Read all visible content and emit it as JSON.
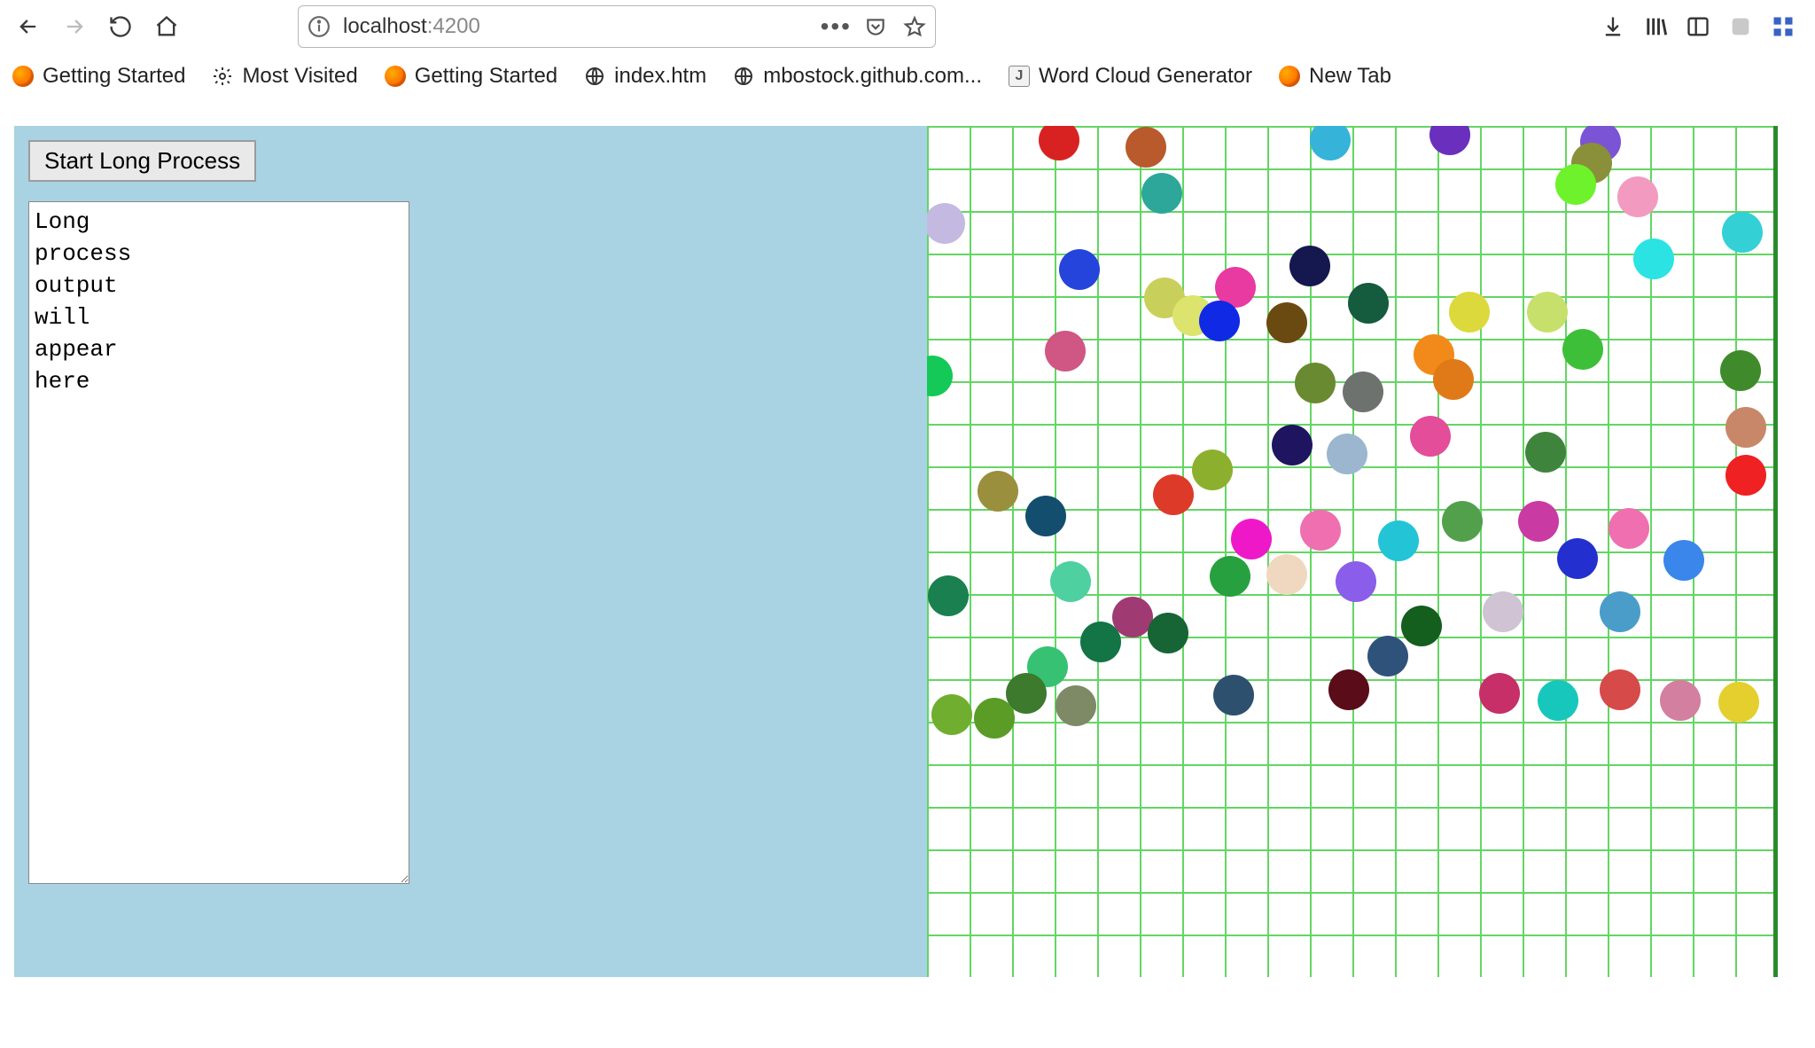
{
  "browser": {
    "url_host": "localhost",
    "url_port": ":4200"
  },
  "bookmarks": [
    {
      "label": "Getting Started",
      "icon": "fx"
    },
    {
      "label": "Most Visited",
      "icon": "gear"
    },
    {
      "label": "Getting Started",
      "icon": "fx"
    },
    {
      "label": "index.htm",
      "icon": "globe"
    },
    {
      "label": "mbostock.github.com...",
      "icon": "globe"
    },
    {
      "label": "Word Cloud Generator",
      "icon": "j"
    },
    {
      "label": "New Tab",
      "icon": "fx"
    }
  ],
  "app": {
    "start_label": "Start Long Process",
    "output_text": "Long\nprocess\noutput\nwill\nappear\nhere"
  },
  "chart_data": {
    "type": "scatter",
    "title": "",
    "xlabel": "",
    "ylabel": "",
    "xlim": [
      0,
      960
    ],
    "ylim": [
      0,
      960
    ],
    "grid": true,
    "grid_spacing": 48,
    "series": [
      {
        "name": "bubbles",
        "points": [
          {
            "x": 149,
            "y": 16,
            "color": "#d82222"
          },
          {
            "x": 247,
            "y": 24,
            "color": "#b85a2b"
          },
          {
            "x": 455,
            "y": 16,
            "color": "#36b3d8"
          },
          {
            "x": 590,
            "y": 10,
            "color": "#6a2fbc"
          },
          {
            "x": 760,
            "y": 18,
            "color": "#7a54d4"
          },
          {
            "x": 750,
            "y": 42,
            "color": "#8a8f3a"
          },
          {
            "x": 265,
            "y": 76,
            "color": "#2ca79a"
          },
          {
            "x": 732,
            "y": 66,
            "color": "#6ef22b"
          },
          {
            "x": 802,
            "y": 80,
            "color": "#f39ac1"
          },
          {
            "x": 20,
            "y": 110,
            "color": "#c4b9e0"
          },
          {
            "x": 920,
            "y": 120,
            "color": "#33d0d6"
          },
          {
            "x": 820,
            "y": 150,
            "color": "#2be3e3"
          },
          {
            "x": 172,
            "y": 162,
            "color": "#2544db"
          },
          {
            "x": 348,
            "y": 182,
            "color": "#e83aa0"
          },
          {
            "x": 432,
            "y": 158,
            "color": "#14184f"
          },
          {
            "x": 268,
            "y": 194,
            "color": "#c8d05b"
          },
          {
            "x": 300,
            "y": 214,
            "color": "#dde46e"
          },
          {
            "x": 330,
            "y": 220,
            "color": "#1029e4"
          },
          {
            "x": 406,
            "y": 222,
            "color": "#6b4a12"
          },
          {
            "x": 498,
            "y": 200,
            "color": "#155b3e"
          },
          {
            "x": 612,
            "y": 210,
            "color": "#dcd93d"
          },
          {
            "x": 700,
            "y": 210,
            "color": "#c7e06c"
          },
          {
            "x": 156,
            "y": 254,
            "color": "#d05683"
          },
          {
            "x": 572,
            "y": 258,
            "color": "#f28a1a"
          },
          {
            "x": 740,
            "y": 252,
            "color": "#3ebf39"
          },
          {
            "x": 918,
            "y": 276,
            "color": "#3f8b2b"
          },
          {
            "x": 6,
            "y": 282,
            "color": "#14c957"
          },
          {
            "x": 438,
            "y": 290,
            "color": "#698a30"
          },
          {
            "x": 492,
            "y": 300,
            "color": "#6d726f"
          },
          {
            "x": 594,
            "y": 286,
            "color": "#e07a18"
          },
          {
            "x": 924,
            "y": 340,
            "color": "#c9876a"
          },
          {
            "x": 568,
            "y": 350,
            "color": "#e34d9a"
          },
          {
            "x": 412,
            "y": 360,
            "color": "#1f1460"
          },
          {
            "x": 474,
            "y": 370,
            "color": "#9bb6ce"
          },
          {
            "x": 698,
            "y": 368,
            "color": "#3f843d"
          },
          {
            "x": 80,
            "y": 412,
            "color": "#9a8f3d"
          },
          {
            "x": 322,
            "y": 388,
            "color": "#8cb02e"
          },
          {
            "x": 278,
            "y": 416,
            "color": "#dd3a2a"
          },
          {
            "x": 924,
            "y": 394,
            "color": "#ef2122"
          },
          {
            "x": 134,
            "y": 440,
            "color": "#134e6f"
          },
          {
            "x": 366,
            "y": 466,
            "color": "#ef18c9"
          },
          {
            "x": 444,
            "y": 456,
            "color": "#ef6fb0"
          },
          {
            "x": 532,
            "y": 468,
            "color": "#22c4d6"
          },
          {
            "x": 604,
            "y": 446,
            "color": "#52a04c"
          },
          {
            "x": 690,
            "y": 446,
            "color": "#c93aa2"
          },
          {
            "x": 792,
            "y": 454,
            "color": "#ef6fb0"
          },
          {
            "x": 734,
            "y": 488,
            "color": "#2330cf"
          },
          {
            "x": 854,
            "y": 490,
            "color": "#3a86ea"
          },
          {
            "x": 24,
            "y": 530,
            "color": "#1a8050"
          },
          {
            "x": 342,
            "y": 508,
            "color": "#27a040"
          },
          {
            "x": 406,
            "y": 506,
            "color": "#f0d8c0"
          },
          {
            "x": 484,
            "y": 514,
            "color": "#8a5eea"
          },
          {
            "x": 162,
            "y": 514,
            "color": "#4ed0a0"
          },
          {
            "x": 196,
            "y": 582,
            "color": "#137446"
          },
          {
            "x": 232,
            "y": 554,
            "color": "#9f3a72"
          },
          {
            "x": 272,
            "y": 572,
            "color": "#176434"
          },
          {
            "x": 558,
            "y": 564,
            "color": "#145e1e"
          },
          {
            "x": 650,
            "y": 548,
            "color": "#cfc3d4"
          },
          {
            "x": 782,
            "y": 548,
            "color": "#4a9dc8"
          },
          {
            "x": 520,
            "y": 598,
            "color": "#2f527a"
          },
          {
            "x": 136,
            "y": 610,
            "color": "#36c272"
          },
          {
            "x": 112,
            "y": 640,
            "color": "#3d7a2e"
          },
          {
            "x": 168,
            "y": 654,
            "color": "#7e8a66"
          },
          {
            "x": 346,
            "y": 642,
            "color": "#2e506f"
          },
          {
            "x": 476,
            "y": 636,
            "color": "#5a0c18"
          },
          {
            "x": 28,
            "y": 664,
            "color": "#6fae2e"
          },
          {
            "x": 76,
            "y": 668,
            "color": "#5a9c26"
          },
          {
            "x": 646,
            "y": 640,
            "color": "#c62f68"
          },
          {
            "x": 712,
            "y": 648,
            "color": "#18c7bc"
          },
          {
            "x": 782,
            "y": 636,
            "color": "#d64a4a"
          },
          {
            "x": 850,
            "y": 648,
            "color": "#d37fa0"
          },
          {
            "x": 916,
            "y": 650,
            "color": "#e4cf2f"
          }
        ]
      }
    ]
  }
}
